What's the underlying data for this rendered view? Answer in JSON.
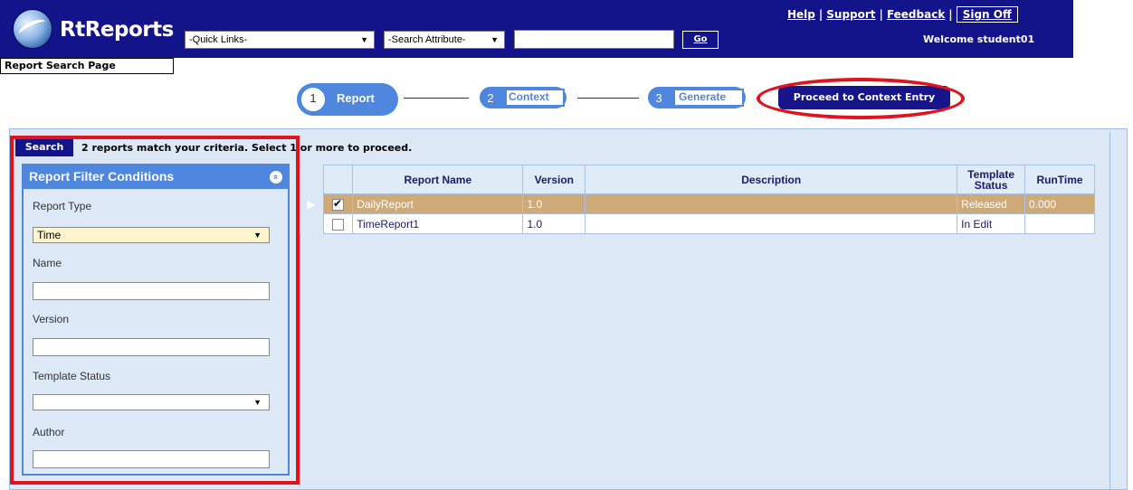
{
  "header": {
    "app_name": "RtReports",
    "page_name": "Report Search Page",
    "quick_links": "-Quick Links-",
    "search_attribute": "-Search Attribute-",
    "search_value": "",
    "go_label": "Go",
    "links": {
      "help": "Help",
      "support": "Support",
      "feedback": "Feedback",
      "signoff": "Sign Off",
      "separator": "|"
    },
    "welcome": "Welcome student01"
  },
  "steps": [
    {
      "num": "1",
      "label": "Report"
    },
    {
      "num": "2",
      "label": "Context"
    },
    {
      "num": "3",
      "label": "Generate"
    }
  ],
  "proceed_label": "Proceed to Context Entry",
  "search": {
    "tab_label": "Search",
    "match_text": "2 reports match your criteria. Select 1 or more to proceed."
  },
  "filter": {
    "title": "Report Filter Conditions",
    "collapse_glyph": "»",
    "report_type_label": "Report Type",
    "report_type_value": "Time",
    "name_label": "Name",
    "version_label": "Version",
    "template_status_label": "Template Status",
    "template_status_value": "",
    "author_label": "Author",
    "select_arrow": "▼"
  },
  "grid": {
    "columns": [
      "Report Name",
      "Version",
      "Description",
      "Template Status",
      "RunTime"
    ],
    "rows": [
      {
        "name": "DailyReport",
        "version": "1.0",
        "description": "",
        "status": "Released",
        "runtime": "0.000",
        "selected": true,
        "pointer": "▶"
      },
      {
        "name": "TimeReport1",
        "version": "1.0",
        "description": "",
        "status": "In Edit",
        "runtime": "",
        "selected": false,
        "pointer": ""
      }
    ]
  },
  "colors": {
    "banner": "#14148a",
    "accent": "#4f86de",
    "highlight": "#e0141e",
    "selected_row": "#cdaa78"
  }
}
